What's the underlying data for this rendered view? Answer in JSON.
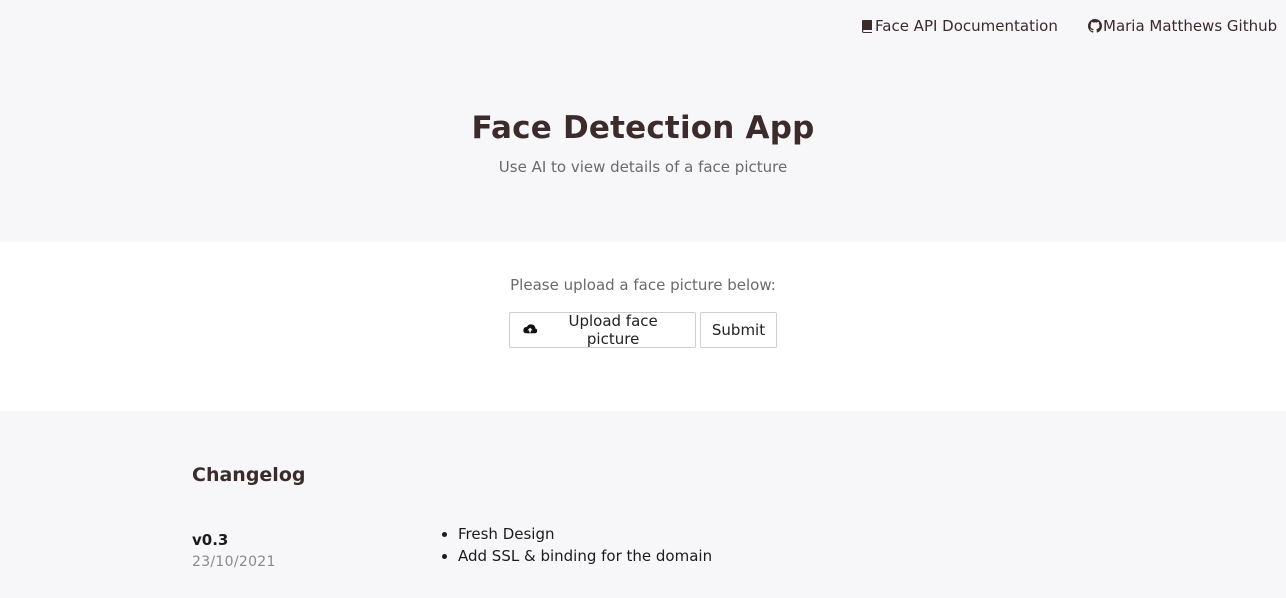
{
  "nav": {
    "docs_label": "Face API Documentation",
    "github_label": "Maria Matthews Github"
  },
  "hero": {
    "title": "Face Detection App",
    "subtitle": "Use AI to view details of a face picture"
  },
  "upload": {
    "prompt": "Please upload a face picture below:",
    "upload_button": "Upload face picture",
    "submit_button": "Submit"
  },
  "changelog": {
    "heading": "Changelog",
    "entries": [
      {
        "version": "v0.3",
        "date": "23/10/2021",
        "changes": [
          "Fresh Design",
          "Add SSL & binding for the domain"
        ]
      }
    ]
  },
  "icons": {
    "docs": "book-icon",
    "github": "github-icon",
    "upload": "cloud-upload-icon"
  },
  "colors": {
    "text_primary": "#3b2b2b",
    "text_muted": "#6a6a6a",
    "background_light": "#f7f6f8",
    "background_white": "#ffffff"
  }
}
